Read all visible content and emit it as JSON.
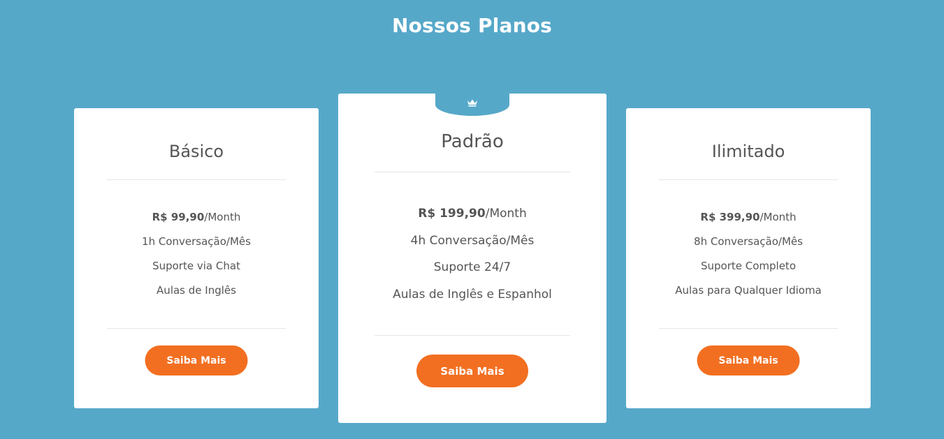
{
  "page": {
    "title": "Nossos Planos",
    "colors": {
      "background": "#56a8c9",
      "card": "#ffffff",
      "accent": "#f26f21",
      "text": "#555555"
    }
  },
  "plans": [
    {
      "name": "Básico",
      "price": "R$ 99,90",
      "period": "/Month",
      "features": [
        "1h Conversação/Mês",
        "Suporte via Chat",
        "Aulas de Inglês"
      ],
      "button_label": "Saiba Mais"
    },
    {
      "name": "Padrão",
      "featured": true,
      "badge_icon": "crown-icon",
      "price": "R$ 199,90",
      "period": "/Month",
      "features": [
        "4h Conversação/Mês",
        "Suporte 24/7",
        "Aulas de Inglês e Espanhol"
      ],
      "button_label": "Saiba Mais"
    },
    {
      "name": "Ilimitado",
      "price": "R$ 399,90",
      "period": "/Month",
      "features": [
        "8h Conversação/Mês",
        "Suporte Completo",
        "Aulas para Qualquer Idioma"
      ],
      "button_label": "Saiba Mais"
    }
  ]
}
